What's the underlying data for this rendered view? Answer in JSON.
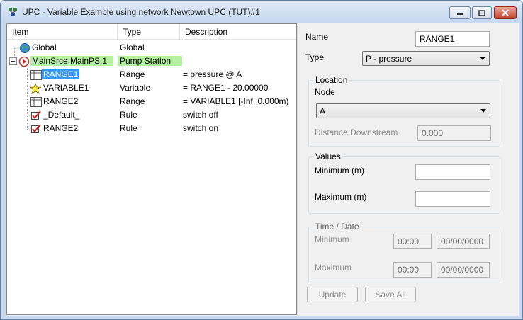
{
  "window": {
    "title": "UPC - Variable Example using network Newtown UPC (TUT)#1"
  },
  "tree": {
    "columns": {
      "item": "Item",
      "type": "Type",
      "description": "Description"
    },
    "rows": [
      {
        "label": "Global",
        "type": "Global",
        "description": "",
        "icon": "globe-icon"
      },
      {
        "label": "MainSrce.MainPS.1",
        "type": "Pump Station",
        "description": "",
        "icon": "pump-station-icon"
      },
      {
        "label": "RANGE1",
        "type": "Range",
        "description": "= pressure @ A",
        "icon": "range-icon"
      },
      {
        "label": "VARIABLE1",
        "type": "Variable",
        "description": "= RANGE1 - 20.00000",
        "icon": "star-icon"
      },
      {
        "label": "RANGE2",
        "type": "Range",
        "description": "= VARIABLE1 [-Inf, 0.000m)",
        "icon": "range-icon"
      },
      {
        "label": "_Default_",
        "type": "Rule",
        "description": "switch off",
        "icon": "rule-check-icon"
      },
      {
        "label": "RANGE2",
        "type": "Rule",
        "description": "switch on",
        "icon": "rule-check-icon"
      }
    ]
  },
  "form": {
    "name_label": "Name",
    "name_value": "RANGE1",
    "type_label": "Type",
    "type_value": "P - pressure",
    "location_group": "Location",
    "node_label": "Node",
    "node_value": "A",
    "distance_label": "Distance Downstream",
    "distance_value": "0.000",
    "values_group": "Values",
    "minimum_label": "Minimum (m)",
    "minimum_value": "",
    "maximum_label": "Maximum (m)",
    "maximum_value": "",
    "timedate_group": "Time / Date",
    "td_minimum_label": "Minimum",
    "td_min_time": "00:00",
    "td_min_date": "00/00/0000",
    "td_maximum_label": "Maximum",
    "td_max_time": "00:00",
    "td_max_date": "00/00/0000",
    "update_button": "Update",
    "saveall_button": "Save All"
  },
  "colors": {
    "selection": "#3399ff",
    "highlight": "#b5f0a0"
  }
}
